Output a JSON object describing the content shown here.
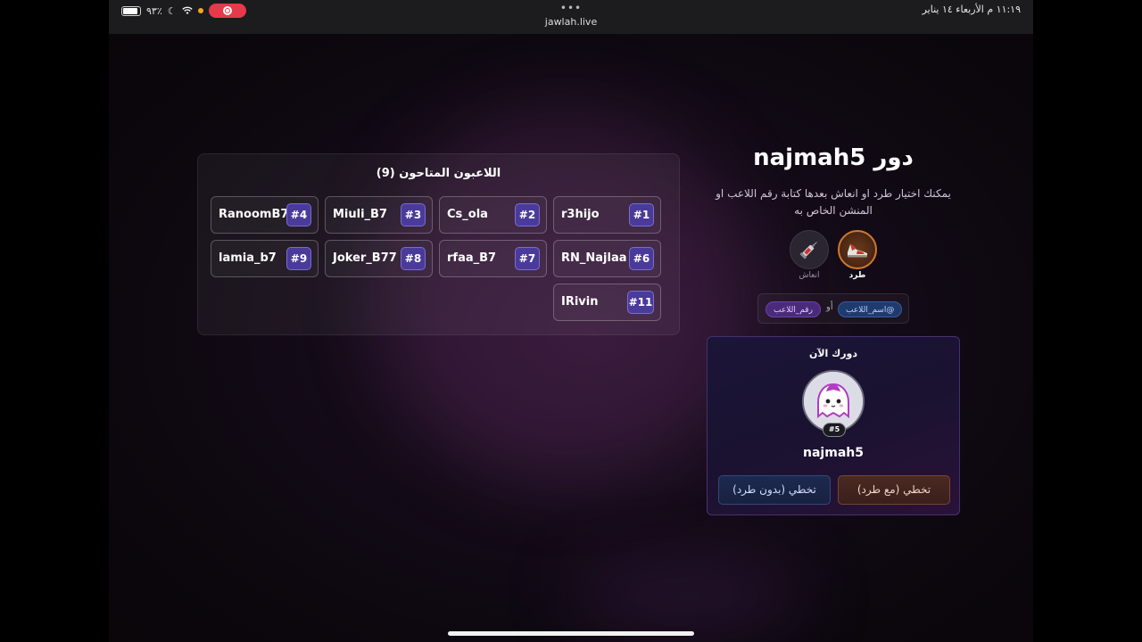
{
  "status_bar": {
    "battery": "٩٣٪",
    "url": "jawlah.live",
    "datetime": "١١:١٩ م   الأربعاء ١٤ يناير"
  },
  "players": {
    "title": "اللاعبون المتاحون (9)",
    "items": [
      {
        "name": "r3hijo",
        "badge": "#1"
      },
      {
        "name": "Cs_ola",
        "badge": "#2"
      },
      {
        "name": "Miuli_B7",
        "badge": "#3"
      },
      {
        "name": "RanoomB7",
        "badge": "#4"
      },
      {
        "name": "RN_Najlaa",
        "badge": "#6"
      },
      {
        "name": "rfaa_B7",
        "badge": "#7"
      },
      {
        "name": "Joker_B77",
        "badge": "#8"
      },
      {
        "name": "lamia_b7",
        "badge": "#9"
      },
      {
        "name": "IRivin",
        "badge": "#11"
      }
    ]
  },
  "turn": {
    "title": "دور najmah5",
    "description": "يمكنك اختيار طرد او انعاش بعدها كتابة رقم اللاعب او المنشن الخاص به",
    "kick_label": "طرد",
    "revive_label": "انعاش",
    "mention_chip": "@اسم_اللاعب",
    "or_text": "أو",
    "number_chip": "رقم_اللاعب"
  },
  "current": {
    "title": "دورك الآن",
    "badge": "#5",
    "name": "najmah5",
    "skip_with_kick": "تخطي (مع طرد)",
    "skip_without_kick": "تخطي (بدون طرد)"
  }
}
